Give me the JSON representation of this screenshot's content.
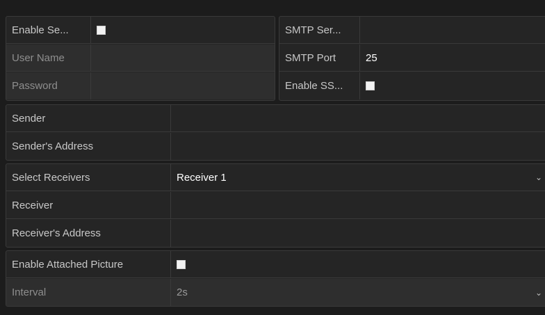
{
  "server_panel": {
    "enable_server_auth_label": "Enable Se...",
    "user_name_label": "User Name",
    "password_label": "Password"
  },
  "smtp_panel": {
    "smtp_server_label": "SMTP Ser...",
    "smtp_port_label": "SMTP Port",
    "smtp_port_value": "25",
    "enable_ssl_label": "Enable SS..."
  },
  "sender_panel": {
    "sender_label": "Sender",
    "sender_address_label": "Sender's Address"
  },
  "receiver_panel": {
    "select_receivers_label": "Select Receivers",
    "select_receivers_value": "Receiver 1",
    "receiver_label": "Receiver",
    "receiver_address_label": "Receiver's Address"
  },
  "attachment_panel": {
    "enable_attached_picture_label": "Enable Attached Picture",
    "interval_label": "Interval",
    "interval_value": "2s"
  },
  "icons": {
    "dropdown": "chevron-down-icon"
  }
}
